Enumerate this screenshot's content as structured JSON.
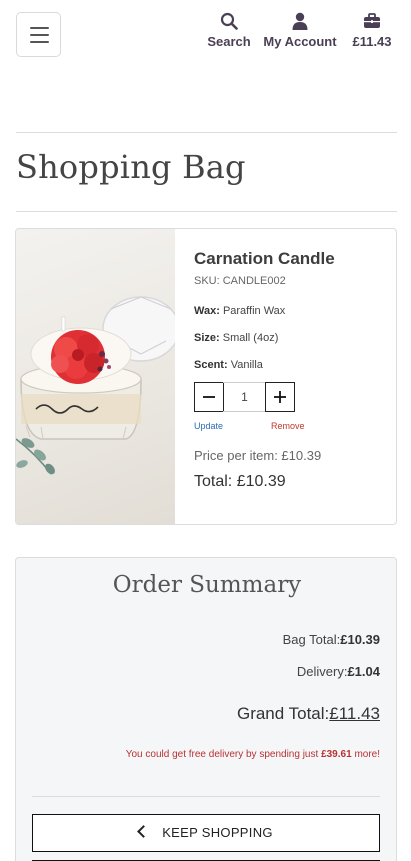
{
  "header": {
    "menu_icon": "hamburger-icon",
    "search_label": "Search",
    "account_label": "My Account",
    "bag_total": "£11.43"
  },
  "page": {
    "title": "Shopping Bag"
  },
  "item": {
    "name": "Carnation Candle",
    "sku": "SKU: CANDLE002",
    "wax_label": "Wax:",
    "wax": "Paraffin Wax",
    "size_label": "Size:",
    "size": "Small (4oz)",
    "scent_label": "Scent:",
    "scent": "Vanilla",
    "quantity": "1",
    "update_label": "Update",
    "remove_label": "Remove",
    "price_per_item": "Price per item: £10.39",
    "total": "Total: £10.39",
    "image_alt": "Carnation candle in a glass jar"
  },
  "summary": {
    "title": "Order Summary",
    "bag_total_label": "Bag Total:",
    "bag_total_value": "£10.39",
    "delivery_label": "Delivery:",
    "delivery_value": "£1.04",
    "grand_total_label": "Grand Total:",
    "grand_total_value": "£11.43",
    "free_delivery_prefix": "You could get free delivery by spending just",
    "free_delivery_amount": "£39.61",
    "free_delivery_suffix": "more!",
    "keep_shopping_label": "KEEP SHOPPING"
  },
  "colors": {
    "accent": "#4a3f55",
    "remove": "#c0392b",
    "update": "#2a6db5"
  }
}
